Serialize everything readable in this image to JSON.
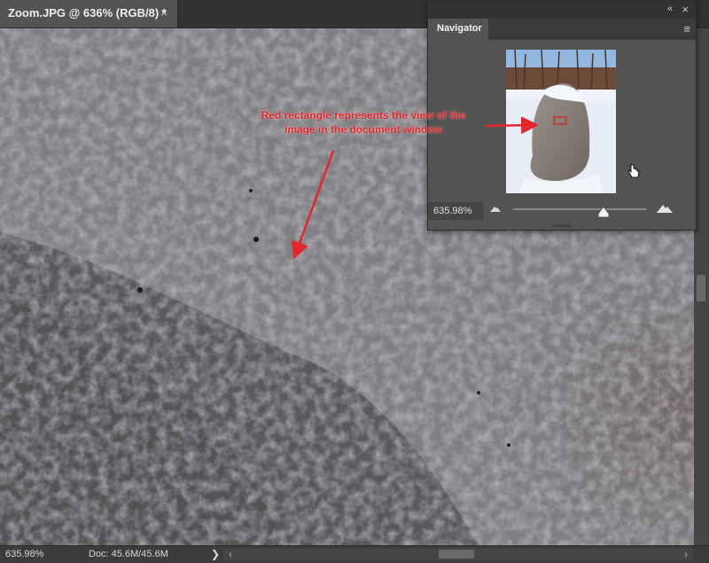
{
  "document": {
    "tab_title": "Zoom.JPG @ 636% (RGB/8) *",
    "close_icon": "×"
  },
  "status_bar": {
    "zoom": "635.98%",
    "doc_info": "Doc: 45.6M/45.6M",
    "info_arrow": "❯",
    "scroll_left": "‹",
    "scroll_right": "›"
  },
  "navigator": {
    "title": "Navigator",
    "zoom_value": "635.98%",
    "collapse_icon": "«",
    "close_icon": "×",
    "menu_icon": "≡"
  },
  "annotation": {
    "text": "Red rectangle represents the view of the image in the document window",
    "color": "#e4262b"
  },
  "colors": {
    "canvas": "#7c7a7c",
    "panel": "#535353",
    "annotation_red": "#e4262b"
  }
}
